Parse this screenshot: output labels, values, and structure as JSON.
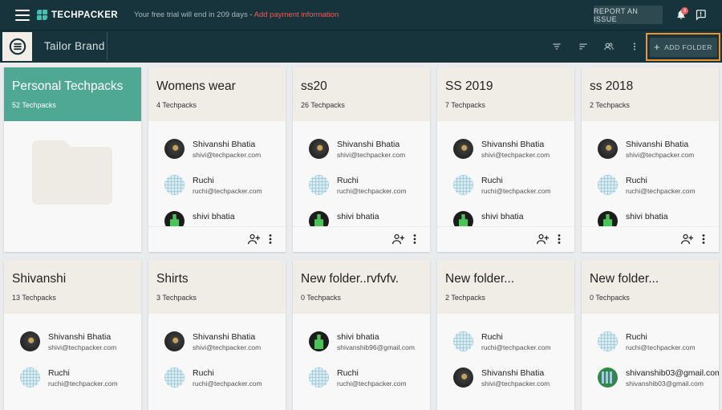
{
  "topbar": {
    "logo_text": "TECHPACKER",
    "trial_text": "Your free trial will end in 209 days",
    "trial_separator": " - ",
    "trial_link": "Add payment information",
    "report_label": "REPORT AN ISSUE",
    "notification_count": "3"
  },
  "brandbar": {
    "brand_name": "Tailor Brand",
    "add_folder_label": "ADD FOLDER",
    "add_folder_symbol": "+"
  },
  "cards": [
    {
      "title": "Personal Techpacks",
      "count": "52 Techpacks",
      "members": []
    },
    {
      "title": "Womens wear",
      "count": "4 Techpacks",
      "members": [
        {
          "name": "Shivanshi Bhatia",
          "email": "shivi@techpacker.com",
          "avatar": "photo"
        },
        {
          "name": "Ruchi",
          "email": "ruchi@techpacker.com",
          "avatar": "pattern"
        },
        {
          "name": "shivi bhatia",
          "email": "",
          "avatar": "green"
        }
      ]
    },
    {
      "title": "ss20",
      "count": "26 Techpacks",
      "members": [
        {
          "name": "Shivanshi Bhatia",
          "email": "shivi@techpacker.com",
          "avatar": "photo"
        },
        {
          "name": "Ruchi",
          "email": "ruchi@techpacker.com",
          "avatar": "pattern"
        },
        {
          "name": "shivi bhatia",
          "email": "",
          "avatar": "green"
        }
      ]
    },
    {
      "title": "SS 2019",
      "count": "7 Techpacks",
      "members": [
        {
          "name": "Shivanshi Bhatia",
          "email": "shivi@techpacker.com",
          "avatar": "photo"
        },
        {
          "name": "Ruchi",
          "email": "ruchi@techpacker.com",
          "avatar": "pattern"
        },
        {
          "name": "shivi bhatia",
          "email": "",
          "avatar": "green"
        }
      ]
    },
    {
      "title": "ss 2018",
      "count": "2 Techpacks",
      "members": [
        {
          "name": "Shivanshi Bhatia",
          "email": "shivi@techpacker.com",
          "avatar": "photo"
        },
        {
          "name": "Ruchi",
          "email": "ruchi@techpacker.com",
          "avatar": "pattern"
        },
        {
          "name": "shivi bhatia",
          "email": "",
          "avatar": "green"
        }
      ]
    },
    {
      "title": "Shivanshi",
      "count": "13 Techpacks",
      "members": [
        {
          "name": "Shivanshi Bhatia",
          "email": "shivi@techpacker.com",
          "avatar": "photo"
        },
        {
          "name": "Ruchi",
          "email": "ruchi@techpacker.com",
          "avatar": "pattern"
        }
      ]
    },
    {
      "title": "Shirts",
      "count": "3 Techpacks",
      "members": [
        {
          "name": "Shivanshi Bhatia",
          "email": "shivi@techpacker.com",
          "avatar": "photo"
        },
        {
          "name": "Ruchi",
          "email": "ruchi@techpacker.com",
          "avatar": "pattern"
        }
      ]
    },
    {
      "title": "New folder..rvfvfv.",
      "count": "0 Techpacks",
      "members": [
        {
          "name": "shivi bhatia",
          "email": "shivanshib96@gmail.com",
          "avatar": "green"
        },
        {
          "name": "Ruchi",
          "email": "ruchi@techpacker.com",
          "avatar": "pattern"
        }
      ]
    },
    {
      "title": "New folder...",
      "count": "2 Techpacks",
      "members": [
        {
          "name": "Ruchi",
          "email": "ruchi@techpacker.com",
          "avatar": "pattern"
        },
        {
          "name": "Shivanshi Bhatia",
          "email": "shivi@techpacker.com",
          "avatar": "photo"
        }
      ]
    },
    {
      "title": "New folder...",
      "count": "0 Techpacks",
      "members": [
        {
          "name": "Ruchi",
          "email": "ruchi@techpacker.com",
          "avatar": "pattern"
        },
        {
          "name": "shivanshib03@gmail.com",
          "email": "shivanshib03@gmail.com",
          "avatar": "pixel"
        }
      ]
    }
  ],
  "colors": {
    "topbar_bg": "#17333b",
    "personal_card_bg": "#4fa894",
    "accent_link": "#f05a5a",
    "highlight_arrow": "#f0932f"
  }
}
